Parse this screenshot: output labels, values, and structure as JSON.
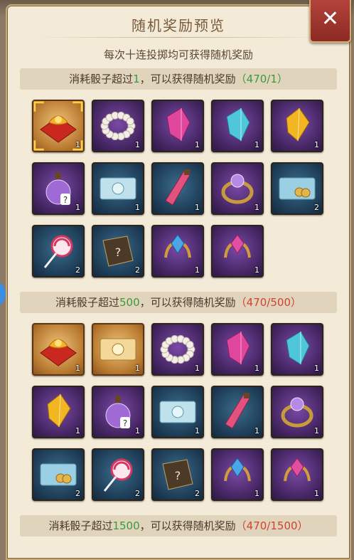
{
  "title": "随机奖励预览",
  "subtitle": "每次十连投掷均可获得随机奖励",
  "close_label": "✕",
  "sections": [
    {
      "prefix": "消耗骰子超过",
      "threshold": "1",
      "suffix": "，可以获得随机奖励",
      "progress": "（470/1）",
      "progress_color": "green",
      "items": [
        {
          "icon": "red-gift-pack-icon",
          "quality": "gold",
          "count": "1"
        },
        {
          "icon": "pearl-necklace-icon",
          "quality": "purple",
          "count": "1"
        },
        {
          "icon": "pink-crystal-icon",
          "quality": "purple",
          "count": "1"
        },
        {
          "icon": "cyan-crystal-icon",
          "quality": "purple",
          "count": "1"
        },
        {
          "icon": "gold-crystal-icon",
          "quality": "purple",
          "count": "1"
        },
        {
          "icon": "mystery-potion-icon",
          "quality": "purple",
          "count": "1"
        },
        {
          "icon": "cat-ticket-icon",
          "quality": "blue",
          "count": "1"
        },
        {
          "icon": "pink-potion-icon",
          "quality": "blue",
          "count": "1"
        },
        {
          "icon": "gem-ring-icon",
          "quality": "purple",
          "count": "1"
        },
        {
          "icon": "coin-ticket-icon",
          "quality": "blue",
          "count": "2"
        },
        {
          "icon": "lollipop-icon",
          "quality": "blue",
          "count": "2"
        },
        {
          "icon": "mystery-book-icon",
          "quality": "blue",
          "count": "2"
        },
        {
          "icon": "blue-gem-antler-icon",
          "quality": "purple",
          "count": "1"
        },
        {
          "icon": "pink-gem-antler-icon",
          "quality": "purple",
          "count": "1"
        }
      ]
    },
    {
      "prefix": "消耗骰子超过",
      "threshold": "500",
      "suffix": "，可以获得随机奖励",
      "progress": "（470/500）",
      "progress_color": "red",
      "items": [
        {
          "icon": "red-gift-pack-icon",
          "quality": "gold",
          "count": "1"
        },
        {
          "icon": "gold-ticket-icon",
          "quality": "gold",
          "count": "1"
        },
        {
          "icon": "pearl-necklace-icon",
          "quality": "purple",
          "count": "1"
        },
        {
          "icon": "pink-crystal-icon",
          "quality": "purple",
          "count": "1"
        },
        {
          "icon": "cyan-crystal-icon",
          "quality": "purple",
          "count": "1"
        },
        {
          "icon": "gold-crystal-icon",
          "quality": "purple",
          "count": "1"
        },
        {
          "icon": "mystery-potion-icon",
          "quality": "purple",
          "count": "1"
        },
        {
          "icon": "cat-ticket-icon",
          "quality": "blue",
          "count": "1"
        },
        {
          "icon": "pink-potion-icon",
          "quality": "blue",
          "count": "1"
        },
        {
          "icon": "gem-ring-icon",
          "quality": "purple",
          "count": "1"
        },
        {
          "icon": "coin-ticket-icon",
          "quality": "blue",
          "count": "2"
        },
        {
          "icon": "lollipop-icon",
          "quality": "blue",
          "count": "2"
        },
        {
          "icon": "mystery-book-icon",
          "quality": "blue",
          "count": "2"
        },
        {
          "icon": "blue-gem-antler-icon",
          "quality": "purple",
          "count": "1"
        },
        {
          "icon": "pink-gem-antler-icon",
          "quality": "purple",
          "count": "1"
        }
      ]
    },
    {
      "prefix": "消耗骰子超过",
      "threshold": "1500",
      "suffix": "，可以获得随机奖励",
      "progress": "（470/1500）",
      "progress_color": "red",
      "items": []
    }
  ]
}
